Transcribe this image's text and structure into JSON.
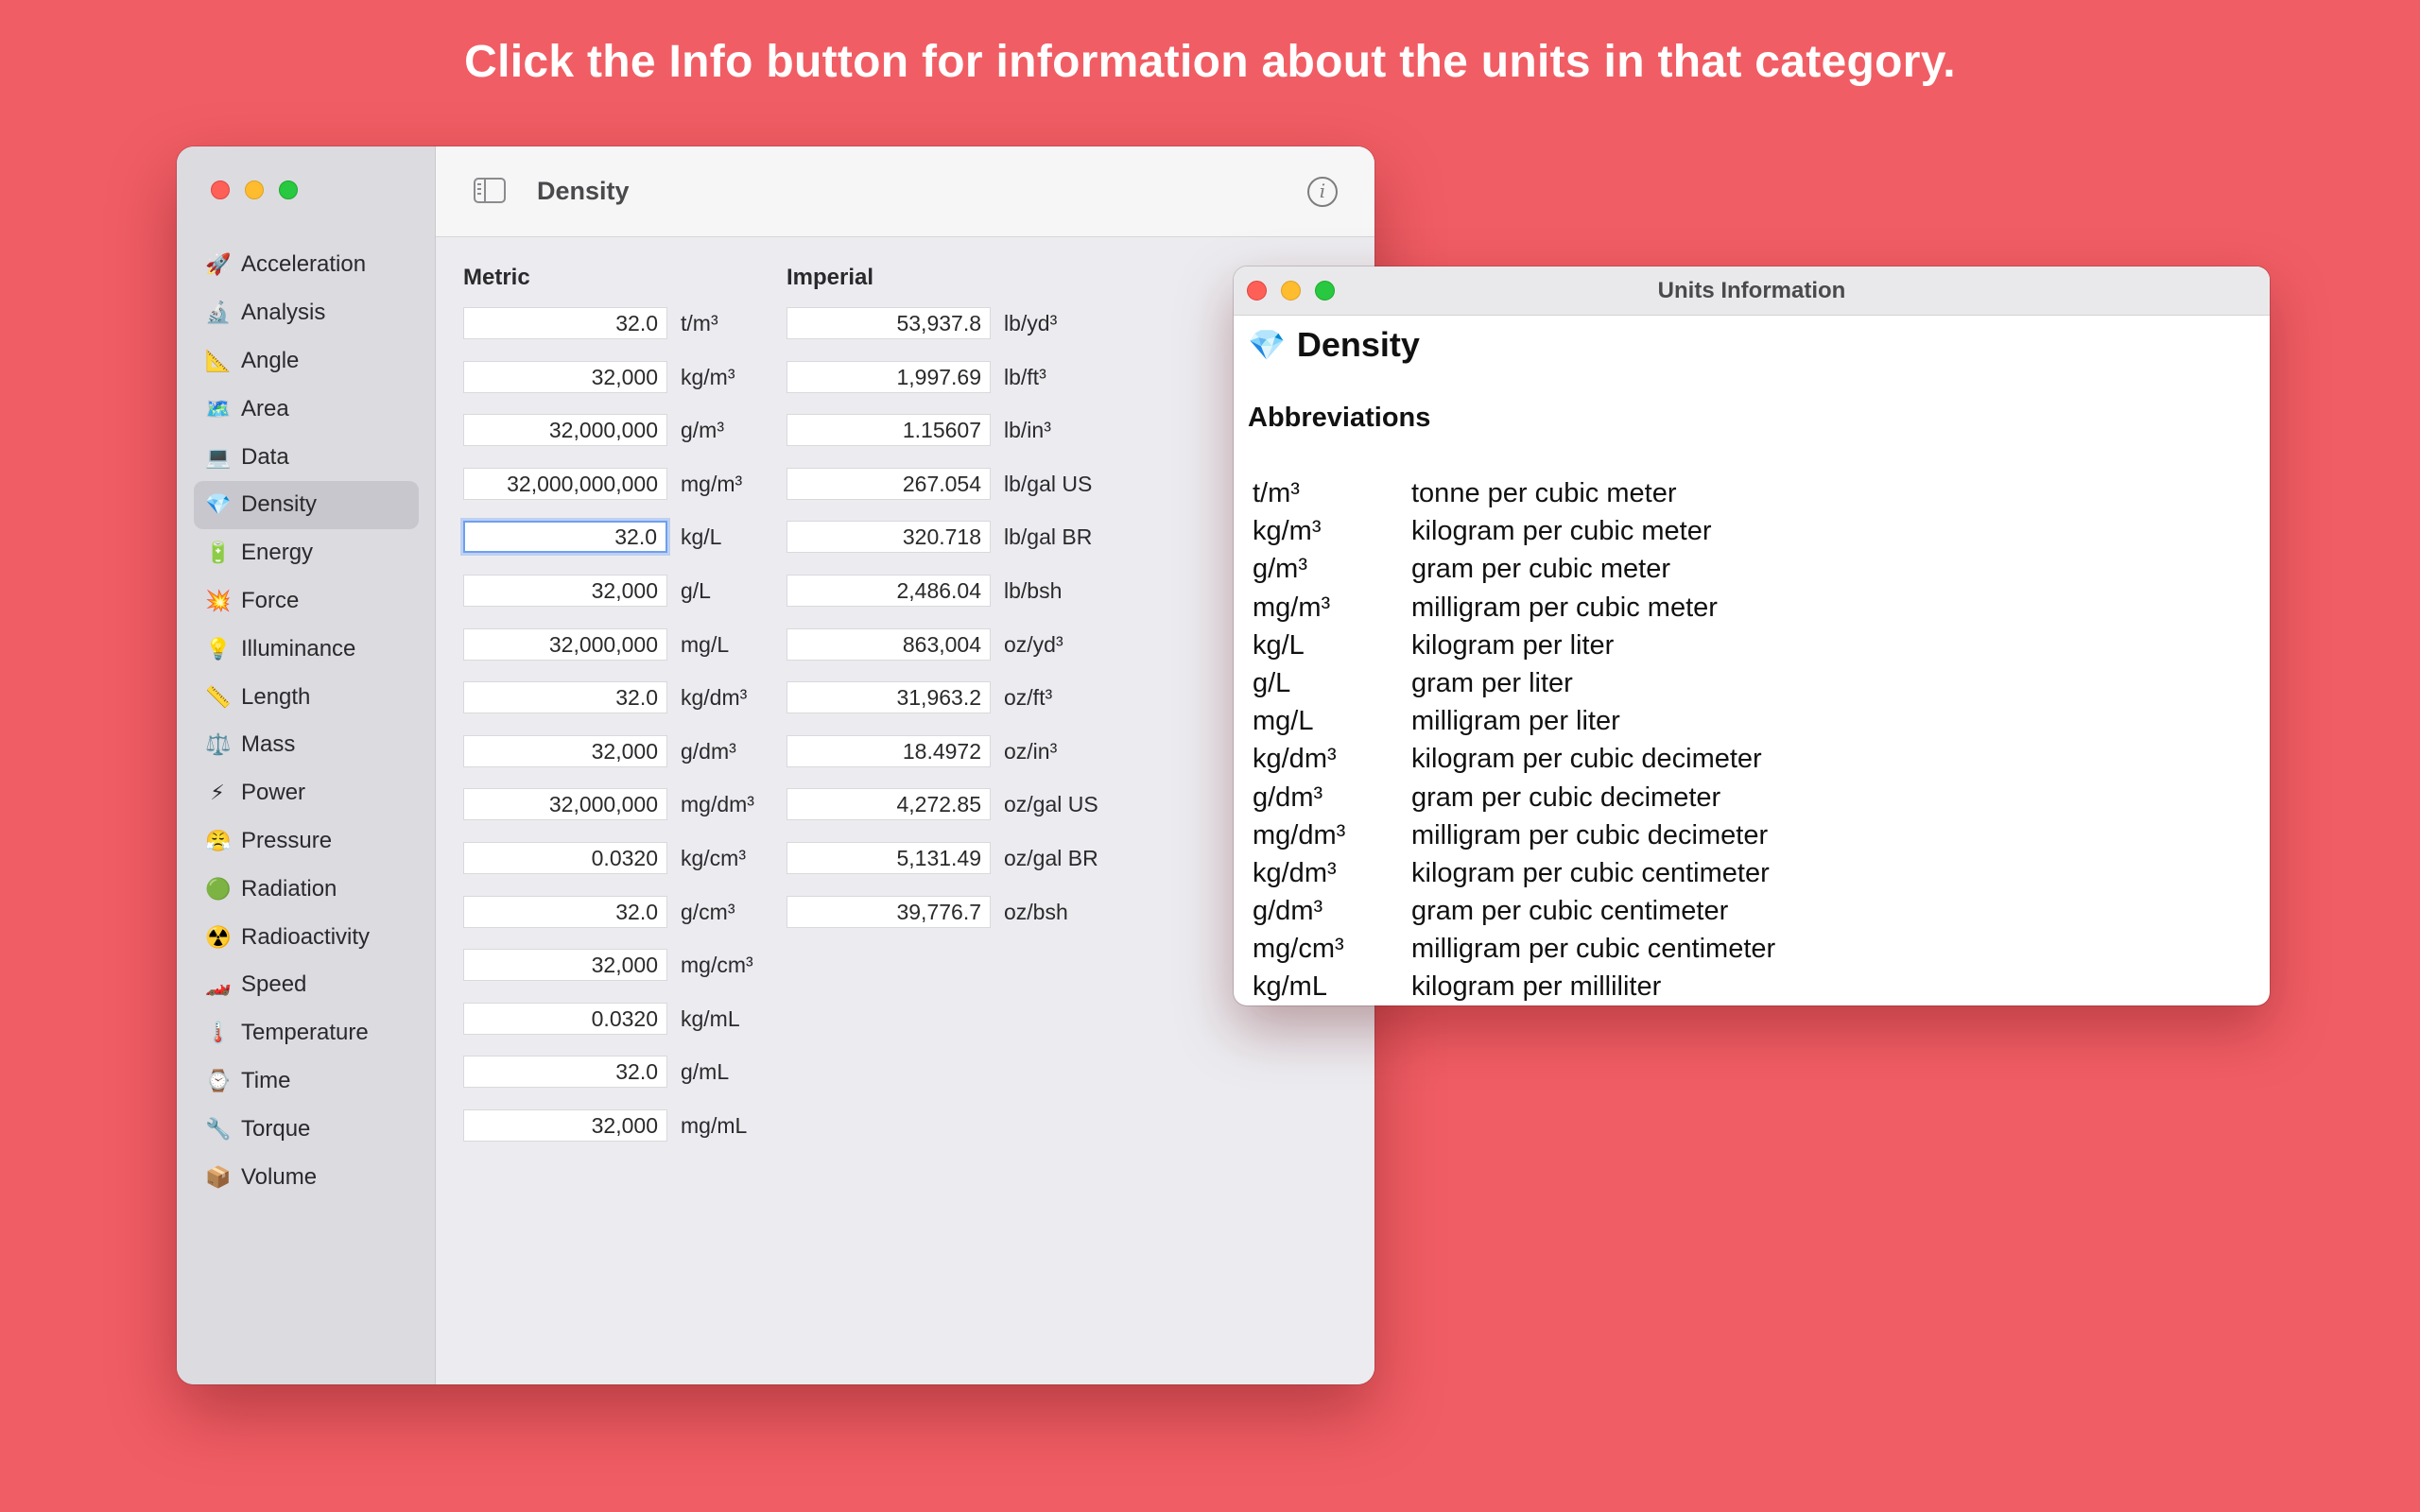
{
  "headline": "Click the Info button for information about the units in that category.",
  "sidebar": {
    "items": [
      {
        "icon": "🚀",
        "icon_name": "rocket-icon",
        "label": "Acceleration"
      },
      {
        "icon": "🔬",
        "icon_name": "microscope-icon",
        "label": "Analysis"
      },
      {
        "icon": "📐",
        "icon_name": "triangle-ruler-icon",
        "label": "Angle"
      },
      {
        "icon": "🗺️",
        "icon_name": "map-icon",
        "label": "Area"
      },
      {
        "icon": "💻",
        "icon_name": "laptop-icon",
        "label": "Data"
      },
      {
        "icon": "💎",
        "icon_name": "gem-icon",
        "label": "Density",
        "selected": true
      },
      {
        "icon": "🔋",
        "icon_name": "battery-icon",
        "label": "Energy"
      },
      {
        "icon": "💥",
        "icon_name": "collision-icon",
        "label": "Force"
      },
      {
        "icon": "💡",
        "icon_name": "light-bulb-icon",
        "label": "Illuminance"
      },
      {
        "icon": "📏",
        "icon_name": "ruler-icon",
        "label": "Length"
      },
      {
        "icon": "⚖️",
        "icon_name": "scales-icon",
        "label": "Mass"
      },
      {
        "icon": "⚡",
        "icon_name": "lightning-icon",
        "label": "Power"
      },
      {
        "icon": "😤",
        "icon_name": "huffing-face-icon",
        "label": "Pressure"
      },
      {
        "icon": "🟢",
        "icon_name": "green-circle-icon",
        "label": "Radiation"
      },
      {
        "icon": "☢️",
        "icon_name": "radioactive-icon",
        "label": "Radioactivity"
      },
      {
        "icon": "🏎️",
        "icon_name": "race-car-icon",
        "label": "Speed"
      },
      {
        "icon": "🌡️",
        "icon_name": "thermometer-icon",
        "label": "Temperature"
      },
      {
        "icon": "⌚",
        "icon_name": "watch-icon",
        "label": "Time"
      },
      {
        "icon": "🔧",
        "icon_name": "wrench-icon",
        "label": "Torque"
      },
      {
        "icon": "📦",
        "icon_name": "package-icon",
        "label": "Volume"
      }
    ]
  },
  "toolbar": {
    "title": "Density",
    "info_glyph": "i"
  },
  "metric": {
    "heading": "Metric",
    "rows": [
      {
        "value": "32.0",
        "unit": "t/m³"
      },
      {
        "value": "32,000",
        "unit": "kg/m³"
      },
      {
        "value": "32,000,000",
        "unit": "g/m³"
      },
      {
        "value": "32,000,000,000",
        "unit": "mg/m³"
      },
      {
        "value": "32.0",
        "unit": "kg/L",
        "focused": true
      },
      {
        "value": "32,000",
        "unit": "g/L"
      },
      {
        "value": "32,000,000",
        "unit": "mg/L"
      },
      {
        "value": "32.0",
        "unit": "kg/dm³"
      },
      {
        "value": "32,000",
        "unit": "g/dm³"
      },
      {
        "value": "32,000,000",
        "unit": "mg/dm³"
      },
      {
        "value": "0.0320",
        "unit": "kg/cm³"
      },
      {
        "value": "32.0",
        "unit": "g/cm³"
      },
      {
        "value": "32,000",
        "unit": "mg/cm³"
      },
      {
        "value": "0.0320",
        "unit": "kg/mL"
      },
      {
        "value": "32.0",
        "unit": "g/mL"
      },
      {
        "value": "32,000",
        "unit": "mg/mL"
      }
    ]
  },
  "imperial": {
    "heading": "Imperial",
    "rows": [
      {
        "value": "53,937.8",
        "unit": "lb/yd³"
      },
      {
        "value": "1,997.69",
        "unit": "lb/ft³"
      },
      {
        "value": "1.15607",
        "unit": "lb/in³"
      },
      {
        "value": "267.054",
        "unit": "lb/gal US"
      },
      {
        "value": "320.718",
        "unit": "lb/gal BR"
      },
      {
        "value": "2,486.04",
        "unit": "lb/bsh"
      },
      {
        "value": "863,004",
        "unit": "oz/yd³"
      },
      {
        "value": "31,963.2",
        "unit": "oz/ft³"
      },
      {
        "value": "18.4972",
        "unit": "oz/in³"
      },
      {
        "value": "4,272.85",
        "unit": "oz/gal US"
      },
      {
        "value": "5,131.49",
        "unit": "oz/gal BR"
      },
      {
        "value": "39,776.7",
        "unit": "oz/bsh"
      }
    ]
  },
  "info_window": {
    "title": "Units Information",
    "heading_icon": "💎",
    "heading": "Density",
    "abbreviations_heading": "Abbreviations",
    "abbreviations": [
      {
        "abbr": "t/m³",
        "name": "tonne per cubic meter"
      },
      {
        "abbr": "kg/m³",
        "name": "kilogram per cubic meter"
      },
      {
        "abbr": "g/m³",
        "name": "gram per cubic meter"
      },
      {
        "abbr": "mg/m³",
        "name": "milligram per cubic meter"
      },
      {
        "abbr": "kg/L",
        "name": "kilogram per liter"
      },
      {
        "abbr": "g/L",
        "name": "gram per liter"
      },
      {
        "abbr": "mg/L",
        "name": "milligram per liter"
      },
      {
        "abbr": "kg/dm³",
        "name": "kilogram per cubic decimeter"
      },
      {
        "abbr": "g/dm³",
        "name": "gram per cubic decimeter"
      },
      {
        "abbr": "mg/dm³",
        "name": "milligram per cubic decimeter"
      },
      {
        "abbr": "kg/dm³",
        "name": "kilogram per cubic centimeter"
      },
      {
        "abbr": "g/dm³",
        "name": "gram per cubic centimeter"
      },
      {
        "abbr": "mg/cm³",
        "name": "milligram per cubic centimeter"
      },
      {
        "abbr": "kg/mL",
        "name": "kilogram per milliliter"
      }
    ]
  },
  "colors": {
    "background": "#f15d64",
    "focus_ring": "#6d9ff0",
    "traffic_red": "#fe5f57",
    "traffic_yellow": "#febc2e",
    "traffic_green": "#28c840"
  }
}
